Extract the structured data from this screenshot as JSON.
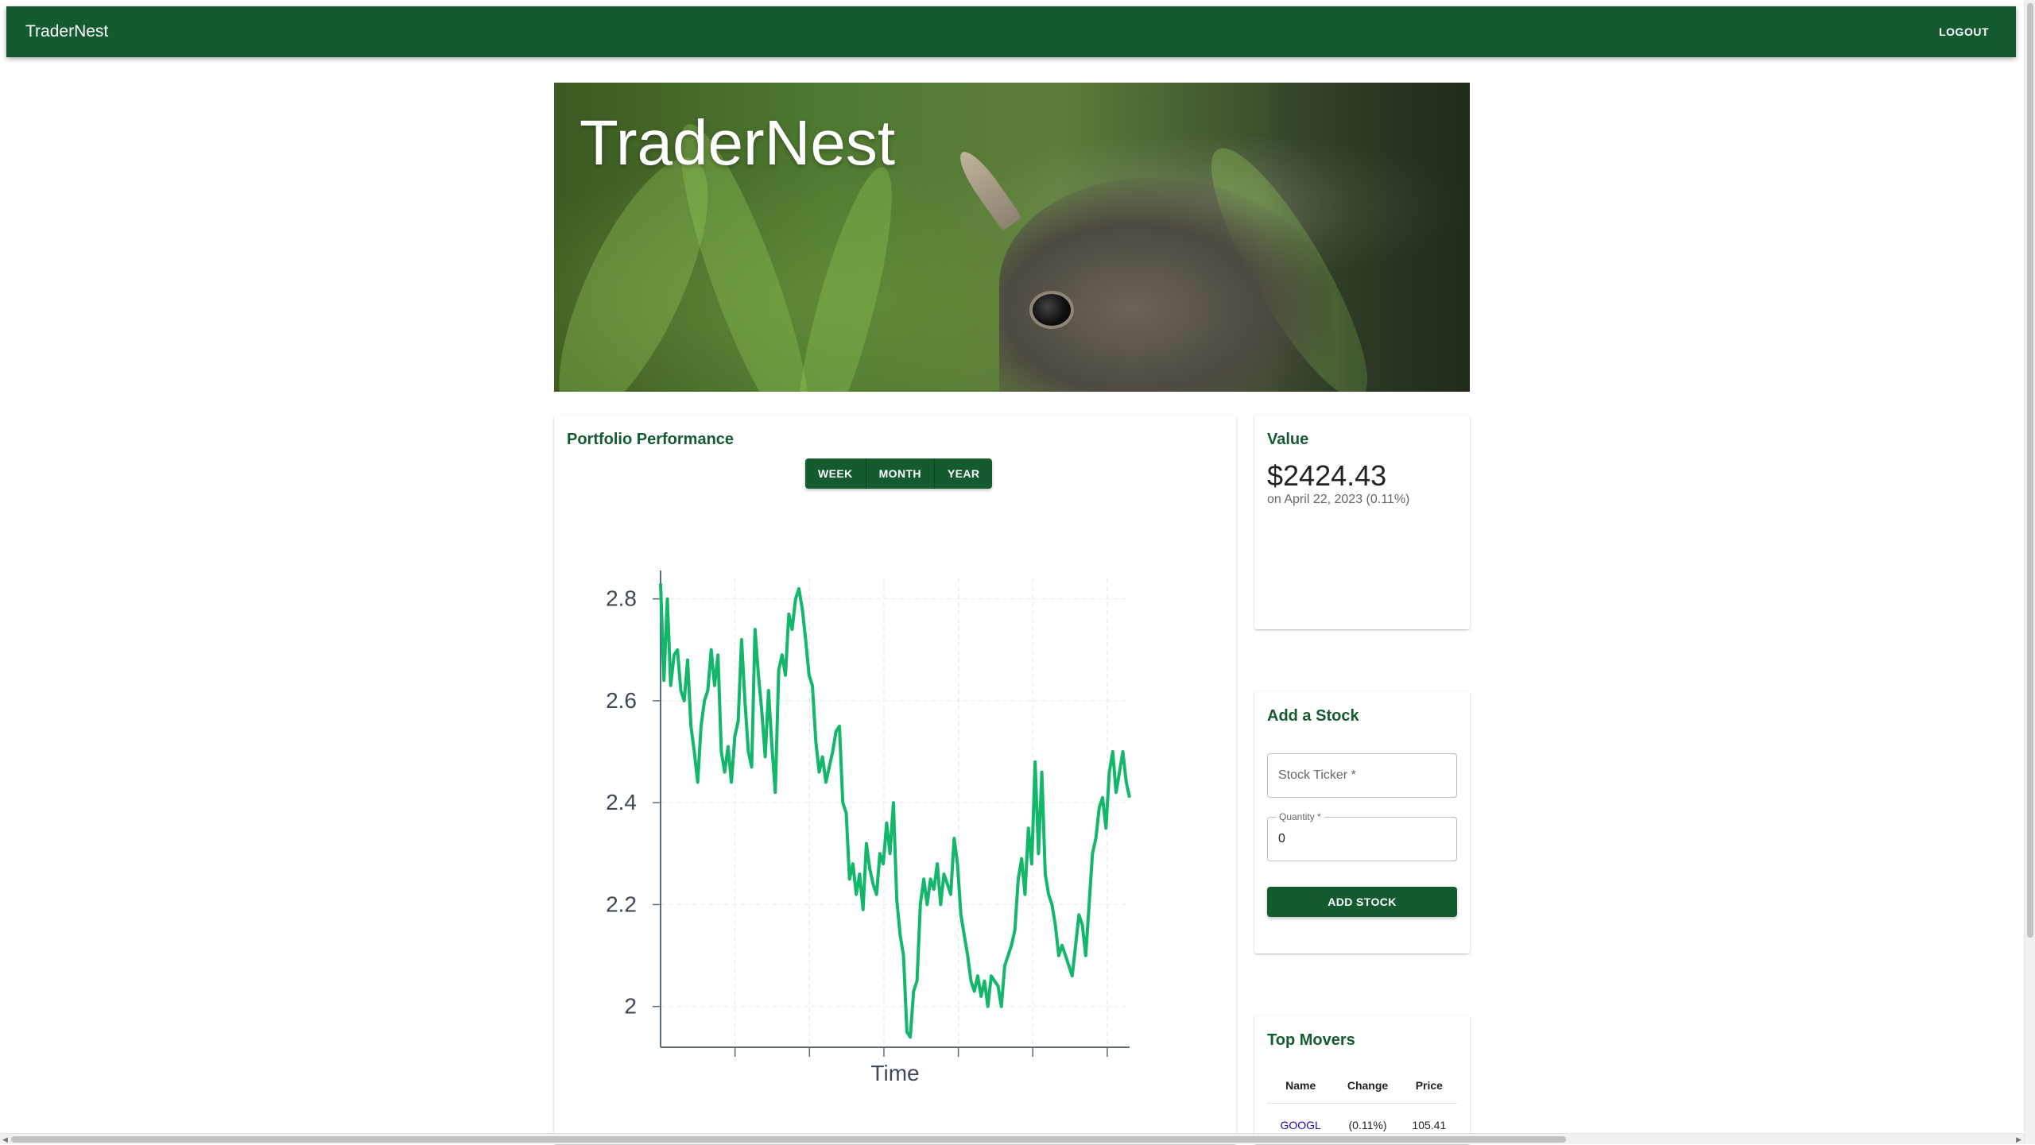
{
  "appbar": {
    "brand": "TraderNest",
    "logout_label": "LOGOUT"
  },
  "hero": {
    "title": "TraderNest"
  },
  "performance": {
    "title": "Portfolio Performance",
    "ranges": [
      "WEEK",
      "MONTH",
      "YEAR"
    ]
  },
  "value": {
    "title": "Value",
    "amount": "$2424.43",
    "subtitle": "on April 22, 2023 (0.11%)"
  },
  "add_stock": {
    "title": "Add a Stock",
    "ticker_placeholder": "Stock Ticker *",
    "quantity_label": "Quantity *",
    "quantity_value": "0",
    "button_label": "ADD STOCK"
  },
  "top_movers": {
    "title": "Top Movers",
    "columns": [
      "Name",
      "Change",
      "Price"
    ],
    "rows": [
      {
        "name": "GOOGL",
        "change": "(0.11%)",
        "price": "105.41"
      }
    ]
  },
  "colors": {
    "brand_green": "#145c30",
    "line_green": "#12b76a"
  },
  "chart_data": {
    "type": "line",
    "title": "",
    "xlabel": "Time",
    "ylabel": "",
    "ylim": [
      1.92,
      2.84
    ],
    "yticks": [
      "2",
      "2.2",
      "2.4",
      "2.6",
      "2.8"
    ],
    "x_tick_count": 6,
    "grid": true,
    "series": [
      {
        "values": [
          2.83,
          2.64,
          2.8,
          2.63,
          2.69,
          2.7,
          2.62,
          2.6,
          2.68,
          2.55,
          2.5,
          2.44,
          2.55,
          2.6,
          2.62,
          2.7,
          2.63,
          2.69,
          2.5,
          2.46,
          2.51,
          2.44,
          2.53,
          2.56,
          2.72,
          2.6,
          2.5,
          2.47,
          2.74,
          2.65,
          2.58,
          2.49,
          2.62,
          2.51,
          2.42,
          2.66,
          2.69,
          2.65,
          2.77,
          2.74,
          2.8,
          2.82,
          2.78,
          2.72,
          2.65,
          2.63,
          2.52,
          2.46,
          2.49,
          2.44,
          2.47,
          2.5,
          2.54,
          2.55,
          2.4,
          2.38,
          2.25,
          2.28,
          2.22,
          2.26,
          2.19,
          2.32,
          2.27,
          2.24,
          2.22,
          2.3,
          2.28,
          2.36,
          2.3,
          2.4,
          2.21,
          2.14,
          2.1,
          1.95,
          1.94,
          2.03,
          2.05,
          2.2,
          2.25,
          2.2,
          2.25,
          2.23,
          2.28,
          2.2,
          2.26,
          2.24,
          2.22,
          2.33,
          2.28,
          2.18,
          2.14,
          2.1,
          2.05,
          2.03,
          2.06,
          2.02,
          2.05,
          2.0,
          2.06,
          2.05,
          2.04,
          2.0,
          2.08,
          2.1,
          2.12,
          2.15,
          2.25,
          2.29,
          2.22,
          2.35,
          2.28,
          2.48,
          2.3,
          2.46,
          2.26,
          2.22,
          2.2,
          2.16,
          2.1,
          2.12,
          2.1,
          2.08,
          2.06,
          2.12,
          2.18,
          2.16,
          2.1,
          2.2,
          2.3,
          2.33,
          2.39,
          2.41,
          2.35,
          2.46,
          2.5,
          2.42,
          2.46,
          2.5,
          2.44,
          2.41
        ]
      }
    ]
  }
}
